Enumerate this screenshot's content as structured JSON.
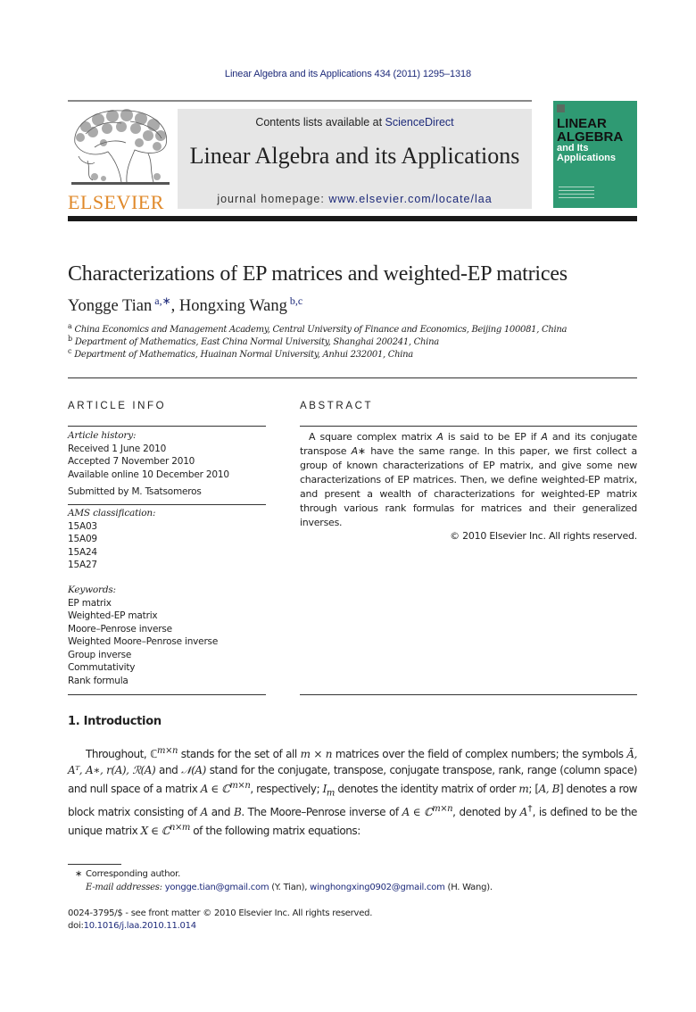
{
  "header": {
    "journal_ref": "Linear Algebra and its Applications 434 (2011) 1295–1318",
    "contents_prefix": "Contents lists available at ",
    "contents_link": "ScienceDirect",
    "journal_name": "Linear Algebra and its Applications",
    "homepage_prefix": "journal homepage: ",
    "homepage_link": "www.elsevier.com/locate/laa",
    "publisher_logo_text": "ELSEVIER",
    "cover": {
      "line1": "LINEAR",
      "line2": "ALGEBRA",
      "line3": "and Its",
      "line4": "Applications",
      "bg_color": "#2f9a73"
    }
  },
  "article": {
    "title": "Characterizations of EP matrices and weighted-EP matrices",
    "authors": [
      {
        "name": "Yongge Tian",
        "marks": "a,∗"
      },
      {
        "name": "Hongxing Wang",
        "marks": "b,c"
      }
    ],
    "author_separator": ", ",
    "affiliations": [
      {
        "mark": "a",
        "text": "China Economics and Management Academy, Central University of Finance and Economics, Beijing 100081, China"
      },
      {
        "mark": "b",
        "text": "Department of Mathematics, East China Normal University, Shanghai 200241, China"
      },
      {
        "mark": "c",
        "text": "Department of Mathematics, Huainan Normal University, Anhui 232001, China"
      }
    ]
  },
  "article_info": {
    "label": "ARTICLE INFO",
    "history_heading": "Article history:",
    "history": [
      "Received 1 June 2010",
      "Accepted 7 November 2010",
      "Available online 10 December 2010"
    ],
    "submitted": "Submitted by M. Tsatsomeros",
    "ams_heading": "AMS classification:",
    "ams": [
      "15A03",
      "15A09",
      "15A24",
      "15A27"
    ],
    "keywords_heading": "Keywords:",
    "keywords": [
      "EP matrix",
      "Weighted-EP matrix",
      "Moore–Penrose inverse",
      "Weighted Moore–Penrose inverse",
      "Group inverse",
      "Commutativity",
      "Rank formula"
    ]
  },
  "abstract": {
    "label": "ABSTRACT",
    "text_1": "A square complex matrix ",
    "text_2": " is said to be EP if ",
    "text_3": " and its conjugate transpose ",
    "text_4": " have the same range. In this paper, we first collect a group of known characterizations of EP matrix, and give some new characterizations of EP matrices. Then, we define weighted-EP matrix, and present a wealth of characterizations for weighted-EP matrix through various rank formulas for matrices and their generalized inverses.",
    "sym_A": "A",
    "sym_Astar": "A∗",
    "copyright": "© 2010 Elsevier Inc. All rights reserved."
  },
  "introduction": {
    "heading": "1. Introduction",
    "s1": "Throughout, ℂ",
    "sup_mn": "m×n",
    "s2": " stands for the set of all ",
    "s3": "m × n",
    "s4": " matrices over the field of complex numbers; the symbols ",
    "s5": "Ā, Aᵀ, A∗, r(A), ℛ(A)",
    "s6": " and ",
    "s7": "𝒩(A)",
    "s8": " stand for the conjugate, transpose, conjugate transpose, rank, range (column space) and null space of a matrix ",
    "s9": "A ∈ ℂ",
    "s10": ", respectively; ",
    "s11": "I",
    "sub_m": "m",
    "s12": " denotes the identity matrix of order ",
    "s13": "m",
    "s14": "; [",
    "s15": "A,  B",
    "s16": "] denotes a row block matrix consisting of ",
    "s17": "A",
    "s18": " and ",
    "s19": "B",
    "s20": ". The Moore–Penrose inverse of ",
    "s21": "A ∈ ℂ",
    "s22": ", denoted by ",
    "s23": "A",
    "sup_dagger": "†",
    "s24": ", is defined to be the unique matrix ",
    "s25": "X ∈ ℂ",
    "sup_nm": "n×m",
    "s26": " of the following matrix equations:"
  },
  "footnotes": {
    "star": "∗",
    "corresponding": "Corresponding author.",
    "email_label": "E-mail addresses: ",
    "email_1": "yongge.tian@gmail.com",
    "email_1_owner": " (Y. Tian), ",
    "email_2": "winghongxing0902@gmail.com",
    "email_2_owner": " (H. Wang)."
  },
  "bottom": {
    "issn": "0024-3795/$ - see front matter © 2010 Elsevier Inc. All rights reserved.",
    "doi_label": "doi:",
    "doi_link": "10.1016/j.laa.2010.11.014"
  }
}
